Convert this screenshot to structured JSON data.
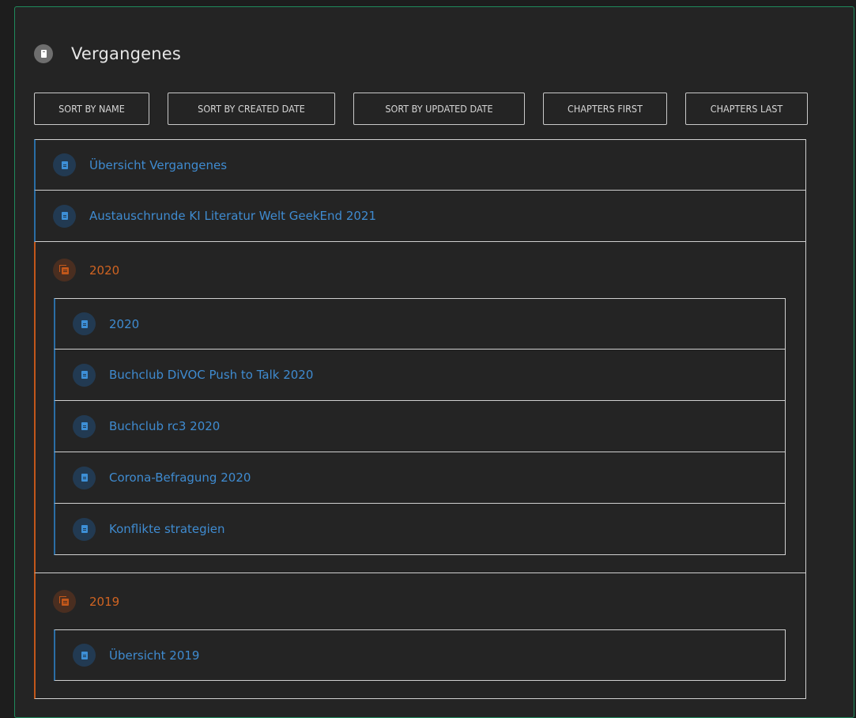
{
  "header": {
    "title": "Vergangenes",
    "icon": "book-icon"
  },
  "sort_buttons": [
    "SORT BY NAME",
    "SORT BY CREATED DATE",
    "SORT BY UPDATED DATE",
    "CHAPTERS FIRST",
    "CHAPTERS LAST"
  ],
  "colors": {
    "page_accent": "#3f8bd0",
    "chapter_accent": "#d06422",
    "panel_border": "#1f8a5c"
  },
  "items": [
    {
      "type": "page",
      "label": "Übersicht Vergangenes"
    },
    {
      "type": "page",
      "label": "Austauschrunde KI Literatur Welt GeekEnd 2021"
    },
    {
      "type": "chapter",
      "label": "2020",
      "pages": [
        "2020",
        "Buchclub DiVOC Push to Talk 2020",
        "Buchclub rc3 2020",
        "Corona-Befragung 2020",
        "Konflikte strategien"
      ]
    },
    {
      "type": "chapter",
      "label": "2019",
      "pages": [
        "Übersicht 2019"
      ]
    }
  ]
}
